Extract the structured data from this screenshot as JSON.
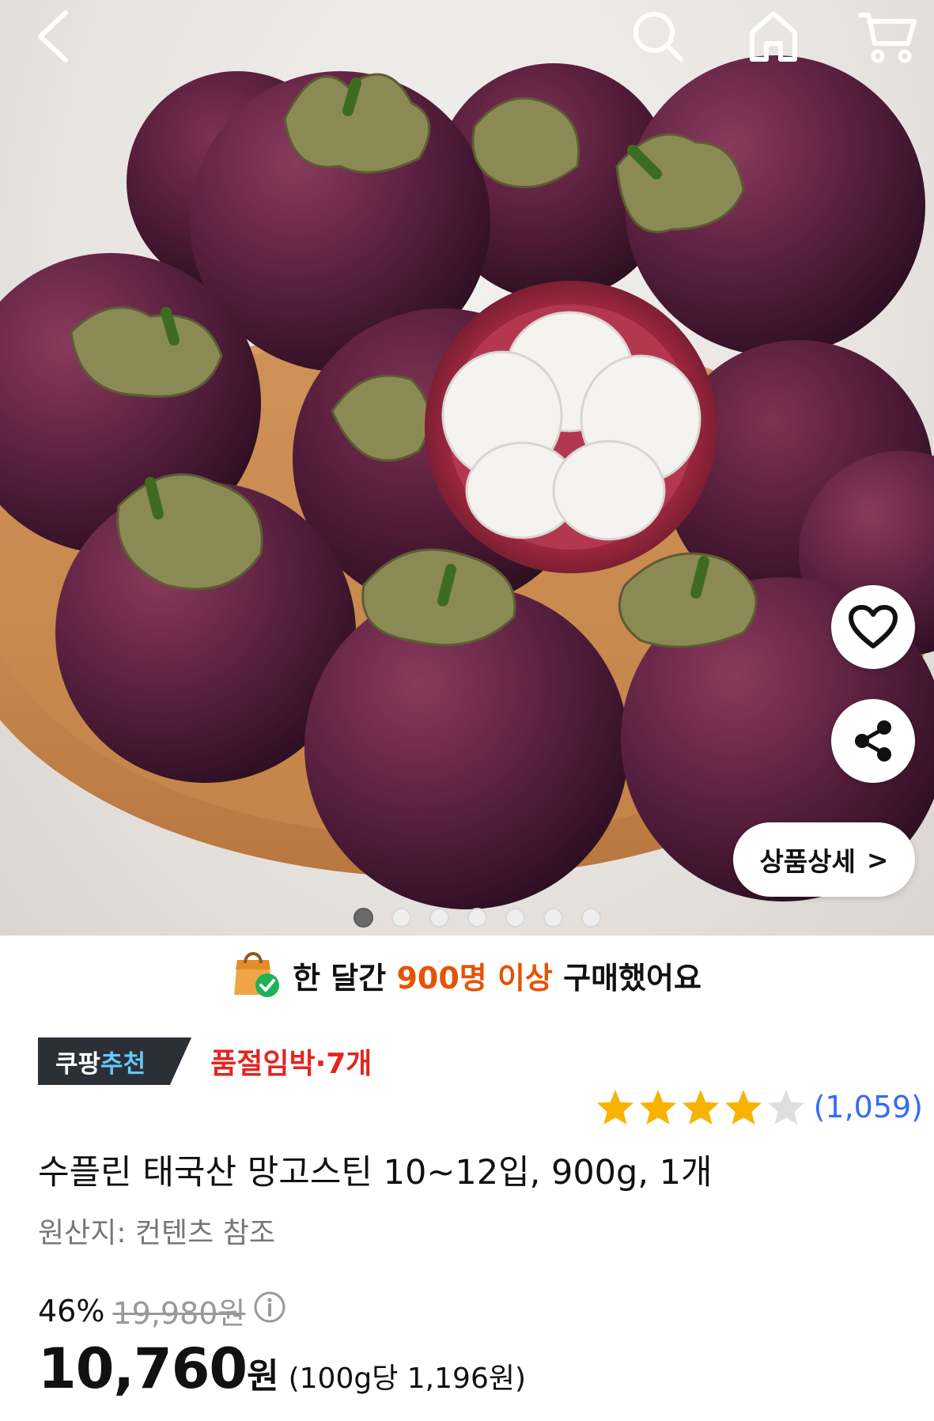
{
  "nav": {
    "back_icon": "chevron-left-icon",
    "search_icon": "search-icon",
    "home_icon": "home-icon",
    "cart_icon": "cart-icon"
  },
  "gallery": {
    "image_count": 7,
    "active_index": 0,
    "wishlist_icon": "heart-icon",
    "share_icon": "share-icon",
    "detail_label": "상품상세",
    "detail_chevron": ">"
  },
  "bought_banner": {
    "prefix": "한 달간",
    "highlight": "900명 이상",
    "suffix": "구매했어요",
    "accent_color": "#e55300"
  },
  "badges": {
    "brand_white": "쿠팡",
    "brand_blue": "추천",
    "soldout": "품절임박·7개"
  },
  "rating": {
    "stars": 4,
    "max_stars": 5,
    "count": "(1,059)",
    "star_color": "#f7b300"
  },
  "product": {
    "title": "수플린 태국산 망고스틴 10~12입, 900g, 1개",
    "origin": "원산지: 컨텐츠 참조"
  },
  "price": {
    "discount": "46%",
    "original": "19,980원",
    "sale": "10,760",
    "sale_unit": "원",
    "per_unit": "(100g당 1,196원)"
  }
}
